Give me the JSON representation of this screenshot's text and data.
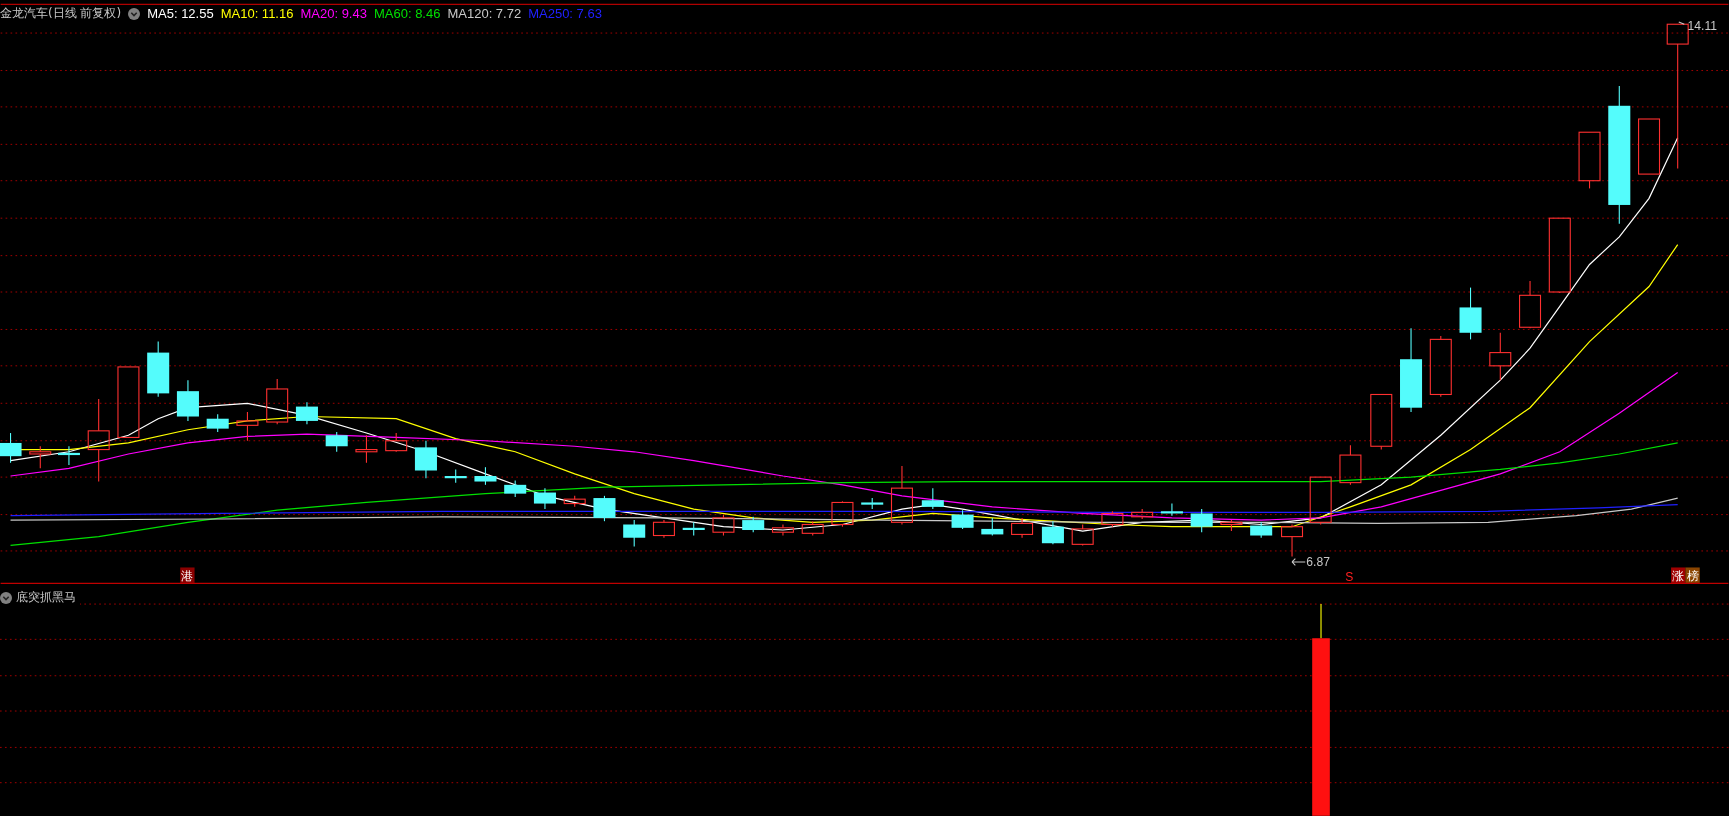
{
  "title_bar": {
    "stock": "金龙汽车(日线 前复权)",
    "ma": [
      {
        "label": "MA5: 12.55",
        "color": "#ffffff"
      },
      {
        "label": "MA10: 11.16",
        "color": "#ffff00"
      },
      {
        "label": "MA20: 9.43",
        "color": "#ff00ff"
      },
      {
        "label": "MA60: 8.46",
        "color": "#00e000"
      },
      {
        "label": "MA120: 7.72",
        "color": "#c8c8c8"
      },
      {
        "label": "MA250: 7.63",
        "color": "#2020ff"
      }
    ]
  },
  "main_chart": {
    "high_label": "14.11",
    "low_label": "6.87",
    "markers": [
      {
        "text": "港",
        "kind": "tag",
        "color": "#8b0000"
      },
      {
        "text": "S",
        "kind": "letter",
        "color": "#ff2020"
      },
      {
        "text": "涨",
        "kind": "tag",
        "color": "#a00000"
      },
      {
        "text": "榜",
        "kind": "tag",
        "color": "#8b4500"
      }
    ]
  },
  "indicator_panel": {
    "title": "底突抓黑马"
  }
}
